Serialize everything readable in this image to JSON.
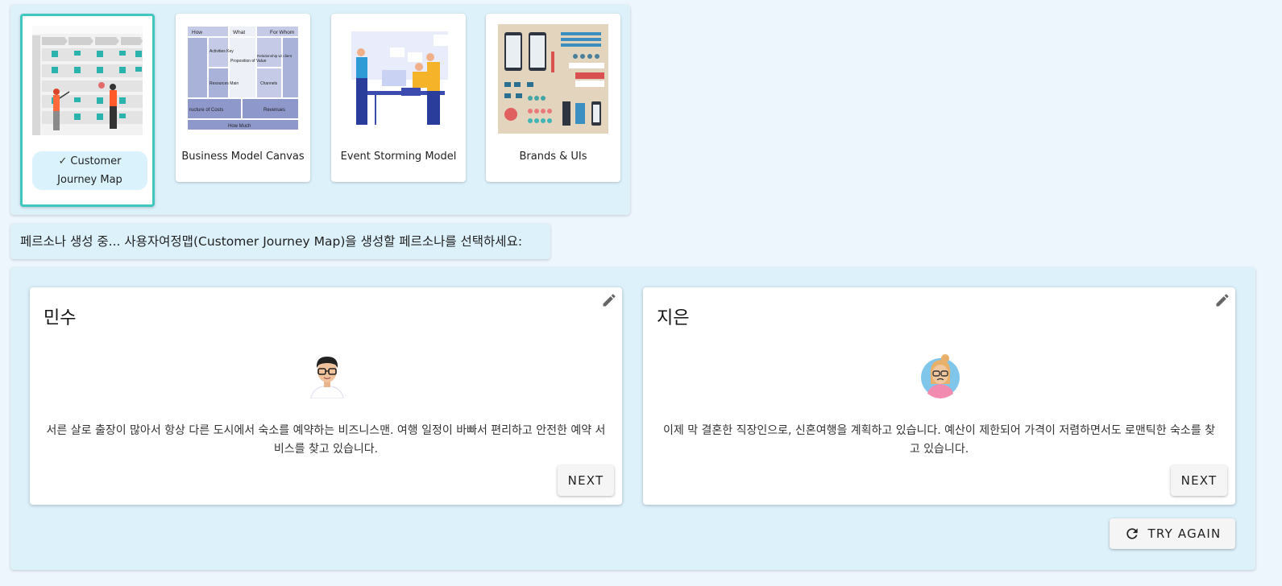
{
  "templates": [
    {
      "label": "Customer Journey Map",
      "selected": true,
      "thumb_icon": "customer-journey-thumbnail"
    },
    {
      "label": "Business Model Canvas",
      "selected": false,
      "thumb_icon": "business-model-canvas-thumbnail"
    },
    {
      "label": "Event Storming Model",
      "selected": false,
      "thumb_icon": "event-storming-thumbnail"
    },
    {
      "label": "Brands & UIs",
      "selected": false,
      "thumb_icon": "brands-uis-thumbnail"
    }
  ],
  "canvas_thumb": {
    "how": "How",
    "what": "What",
    "for_whom": "For Whom",
    "activities": "Activities Key",
    "proposition": "Proposition of Value",
    "relationship": "Relationship w/ client",
    "resources": "Resources Main",
    "channels": "Channels",
    "costs": "ructure of Costs",
    "revenues": "Revenues",
    "how_much": "How Much"
  },
  "status": {
    "text": "페르소나 생성 중... 사용자여정맵(Customer Journey Map)을 생성할 페르소나를 선택하세요:"
  },
  "personas": [
    {
      "name": "민수",
      "avatar_icon": "male-avatar-glasses",
      "description": "서른 살로 출장이 많아서 항상 다른 도시에서 숙소를 예약하는 비즈니스맨. 여행 일정이 바빠서 편리하고 안전한 예약 서비스를 찾고 있습니다.",
      "next_label": "NEXT"
    },
    {
      "name": "지은",
      "avatar_icon": "female-avatar-glasses",
      "description": "이제 막 결혼한 직장인으로, 신혼여행을 계획하고 있습니다. 예산이 제한되어 가격이 저렴하면서도 로맨틱한 숙소를 찾고 있습니다.",
      "next_label": "NEXT"
    }
  ],
  "try_again_label": "TRY AGAIN",
  "colors": {
    "accent": "#3fc7c0",
    "panel_bg": "#ddf1fb",
    "chip_bg": "#d9f2fc",
    "page_bg": "#eef6fd"
  }
}
